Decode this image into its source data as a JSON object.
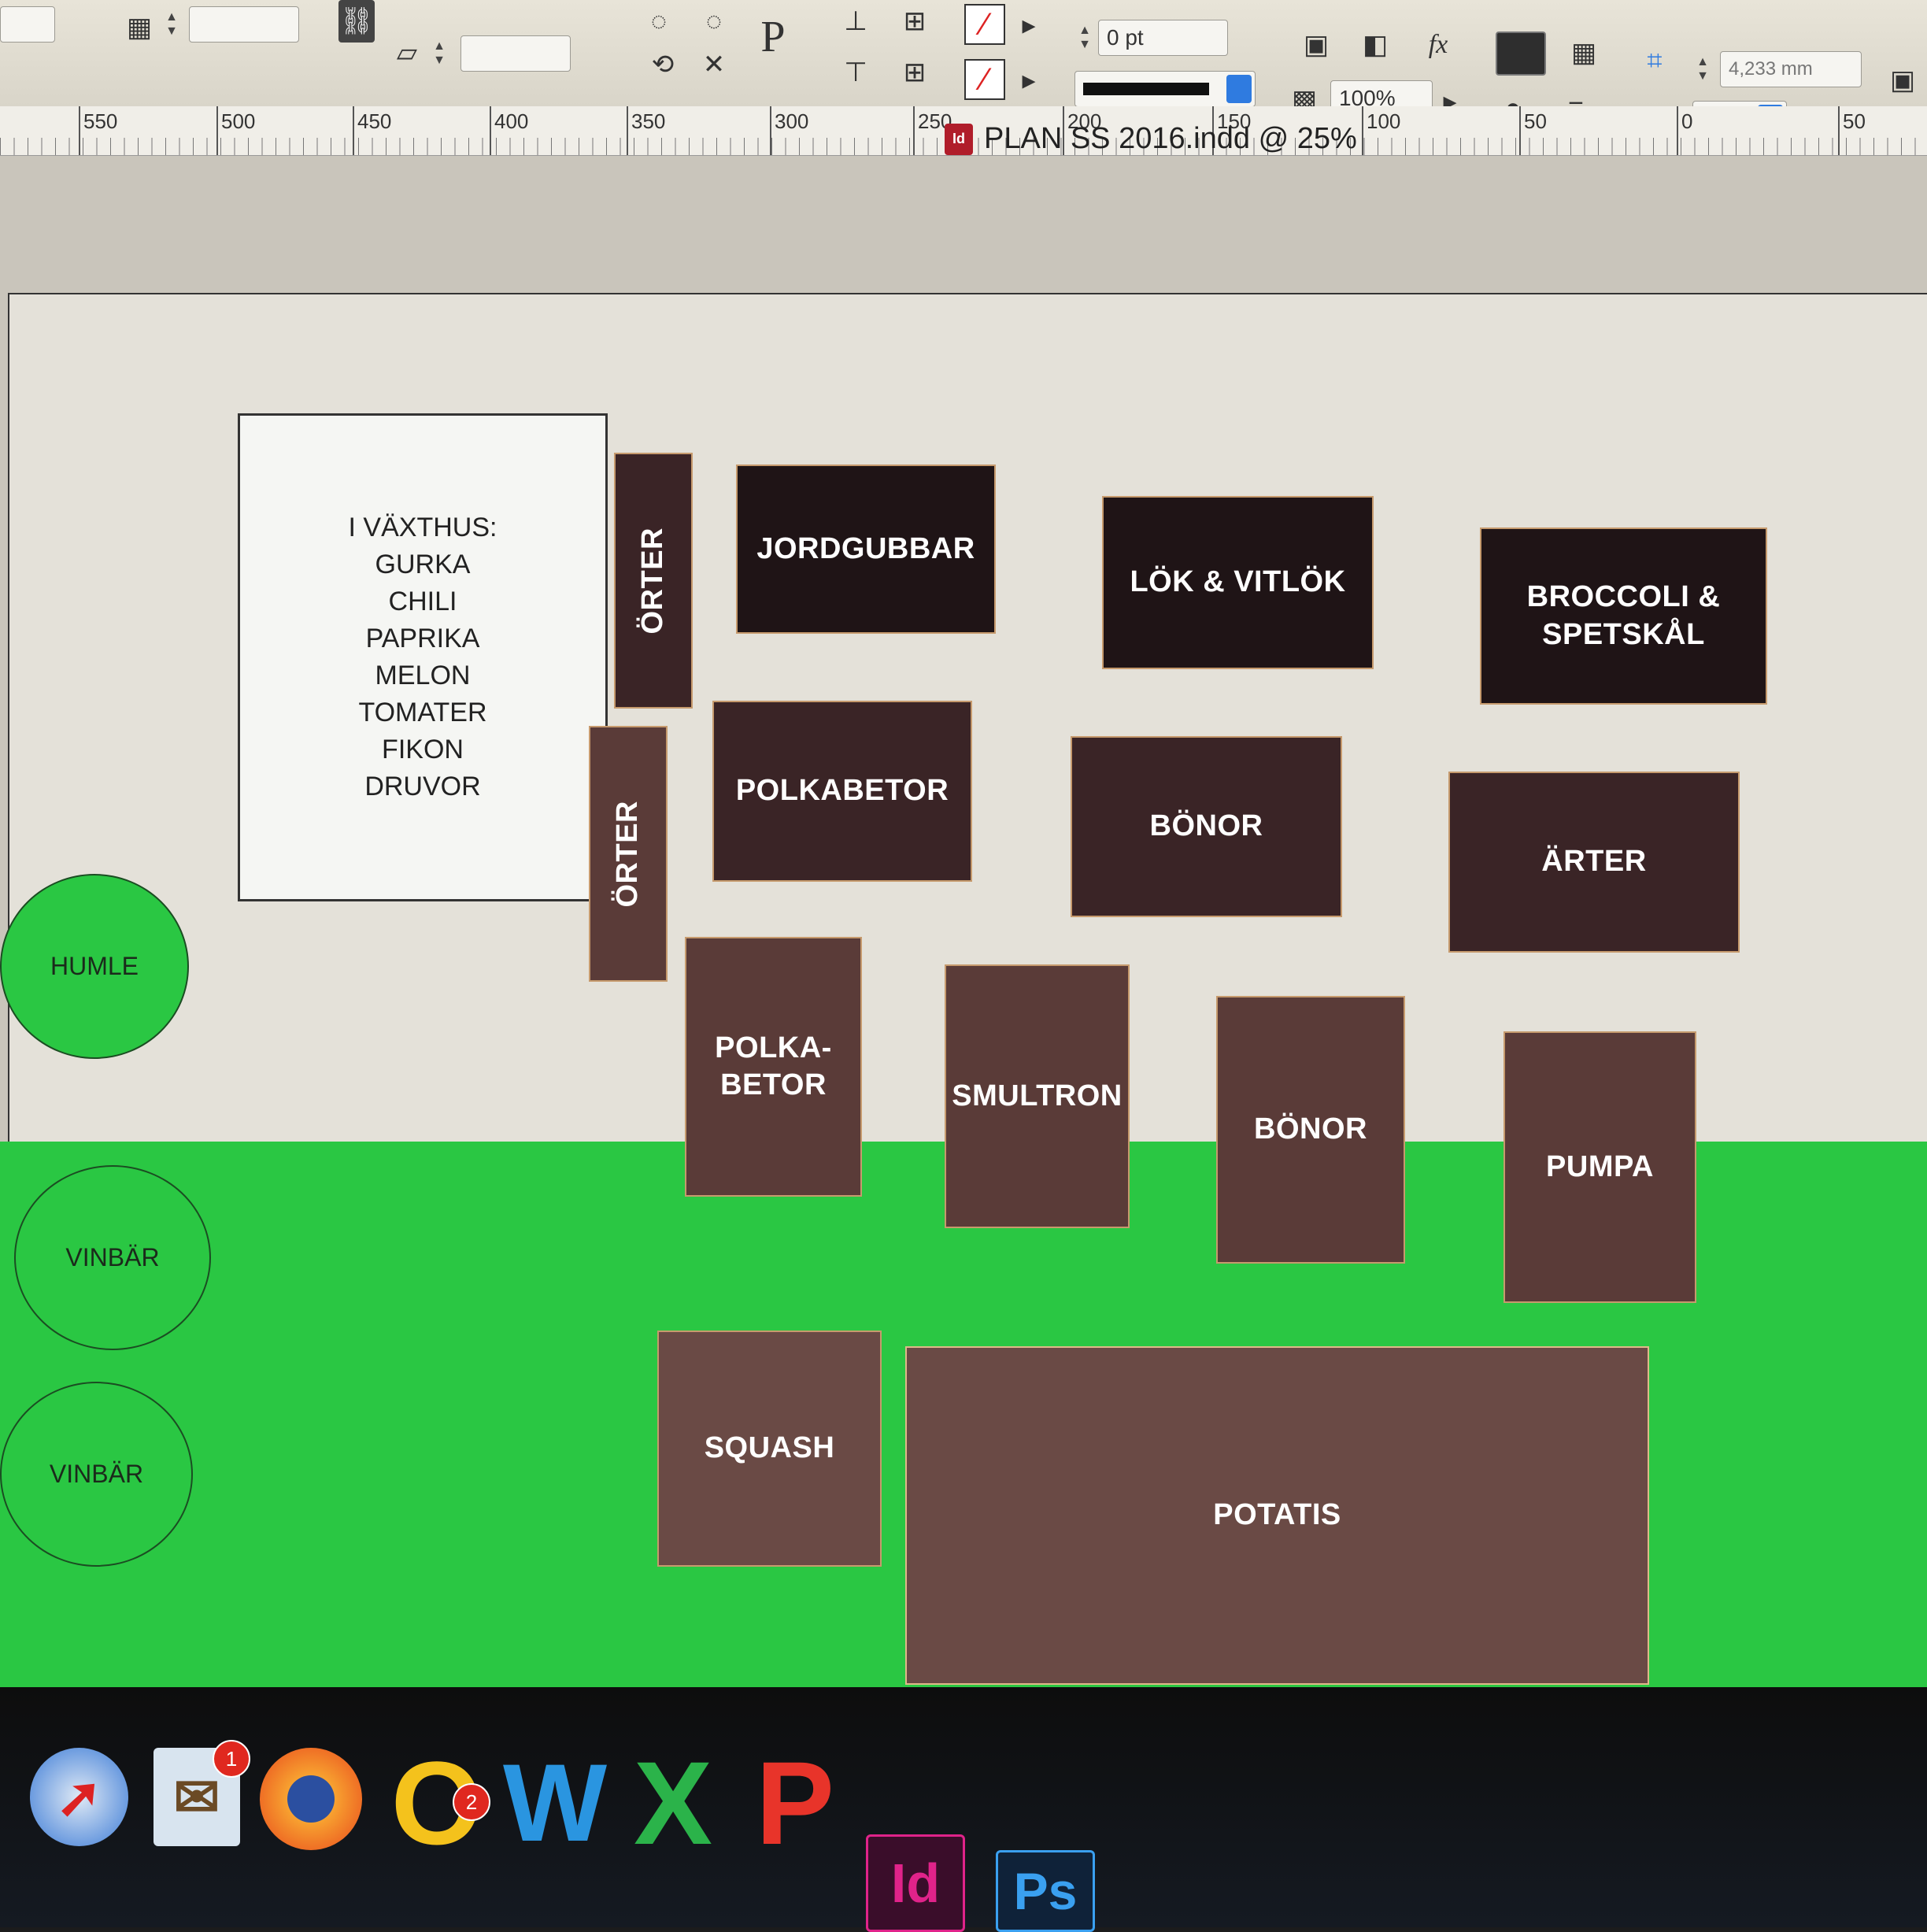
{
  "control_panel": {
    "stroke_weight": "0 pt",
    "opacity": "100%",
    "fx_label": "fx",
    "paragraph_symbol": "P",
    "dimension": "4,233 mm"
  },
  "ruler": {
    "labels": [
      "550",
      "500",
      "450",
      "400",
      "350",
      "300",
      "250",
      "200",
      "150",
      "100",
      "50",
      "0",
      "50"
    ]
  },
  "document": {
    "title": "PLAN SS 2016.indd @ 25%",
    "icon_label": "Id"
  },
  "plan": {
    "greenhouse": {
      "heading": "I VÄXTHUS:",
      "items": [
        "GURKA",
        "CHILI",
        "PAPRIKA",
        "MELON",
        "TOMATER",
        "FIKON",
        "DRUVOR"
      ]
    },
    "herbs": [
      "ÖRTER",
      "ÖRTER"
    ],
    "beds": {
      "jordgubbar": "JORDGUBBAR",
      "lok": "LÖK & VITLÖK",
      "broccoli_line1": "BROCCOLI &",
      "broccoli_line2": "SPETSKÅL",
      "polkabetor": "POLKABETOR",
      "bonor1": "BÖNOR",
      "arter": "ÄRTER",
      "polka_line1": "POLKA-",
      "polka_line2": "BETOR",
      "smultron": "SMULTRON",
      "bonor2": "BÖNOR",
      "pumpa": "PUMPA",
      "squash": "SQUASH",
      "potatis": "POTATIS"
    },
    "bushes": {
      "humle": "HUMLE",
      "vinbar1": "VINBÄR",
      "vinbar2": "VINBÄR"
    },
    "colors": {
      "lawn": "#2ac743",
      "greenhouse": "#f5f6f3",
      "bed_dark": "#1f1416",
      "bed_brown": "#6a4a45"
    }
  },
  "dock": {
    "apps": [
      {
        "name": "Safari",
        "icon": "compass-icon"
      },
      {
        "name": "Mail",
        "icon": "eagle-stamp-icon",
        "badge": "1"
      },
      {
        "name": "Firefox",
        "icon": "firefox-icon"
      },
      {
        "name": "Outlook",
        "letter": "O",
        "badge": "2"
      },
      {
        "name": "Word",
        "letter": "W"
      },
      {
        "name": "Excel",
        "letter": "X"
      },
      {
        "name": "PowerPoint",
        "letter": "P"
      },
      {
        "name": "InDesign",
        "letter": "Id"
      },
      {
        "name": "Photoshop",
        "letter": "Ps"
      }
    ]
  }
}
